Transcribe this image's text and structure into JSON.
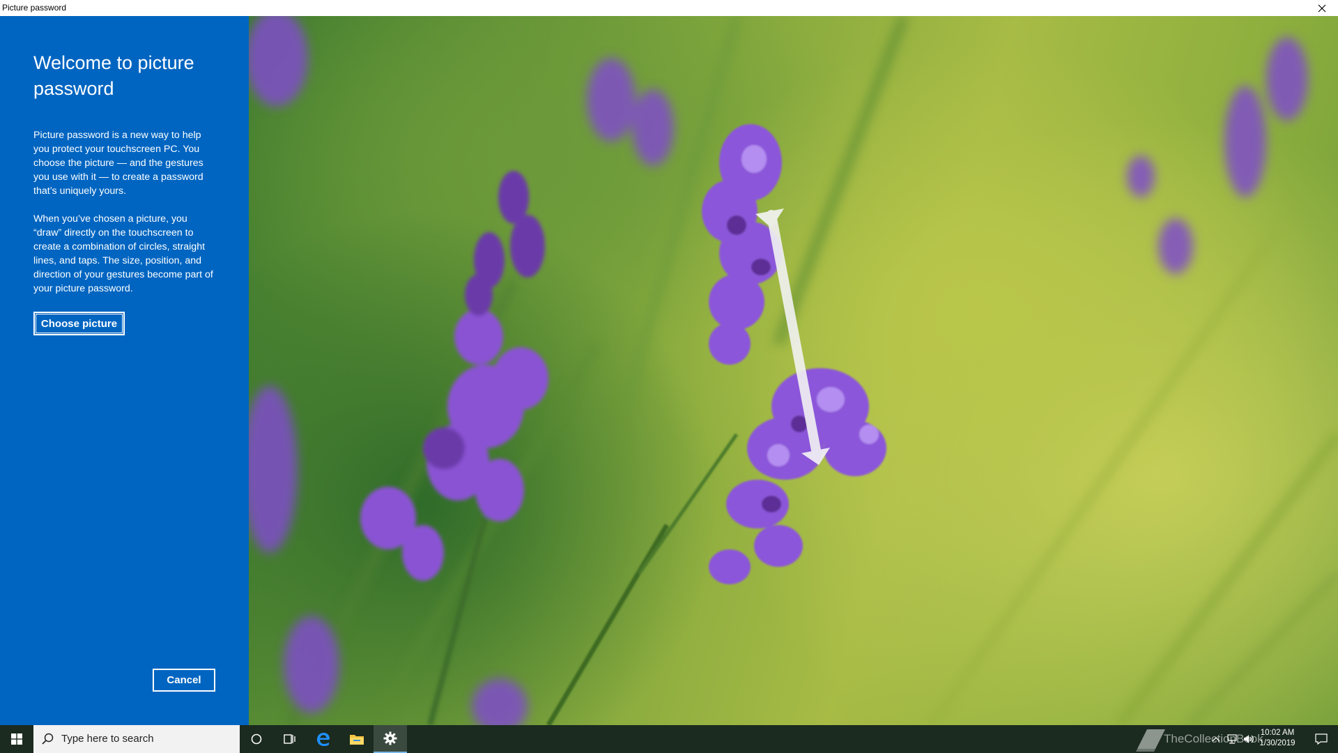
{
  "window": {
    "title": "Picture password"
  },
  "panel": {
    "heading": "Welcome to picture password",
    "paragraph1": "Picture password is a new way to help you protect your touchscreen PC. You choose the picture — and the gestures you use with it — to create a password that’s uniquely yours.",
    "paragraph2": "When you’ve chosen a picture, you “draw” directly on the touchscreen to create a combination of circles, straight lines, and taps. The size, position, and direction of your gestures become part of your picture password.",
    "choose_label": "Choose picture",
    "cancel_label": "Cancel",
    "background_color": "#0065c1"
  },
  "taskbar": {
    "search_placeholder": "Type here to search",
    "clock_time": "10:02 AM",
    "clock_date": "1/30/2019",
    "watermark": "TheCollectionBook",
    "icons": [
      "windows-start-icon",
      "search-icon",
      "cortana-icon",
      "task-view-icon",
      "edge-icon",
      "file-explorer-icon",
      "settings-icon",
      "chevron-up-icon",
      "network-icon",
      "volume-icon",
      "action-center-icon"
    ]
  }
}
